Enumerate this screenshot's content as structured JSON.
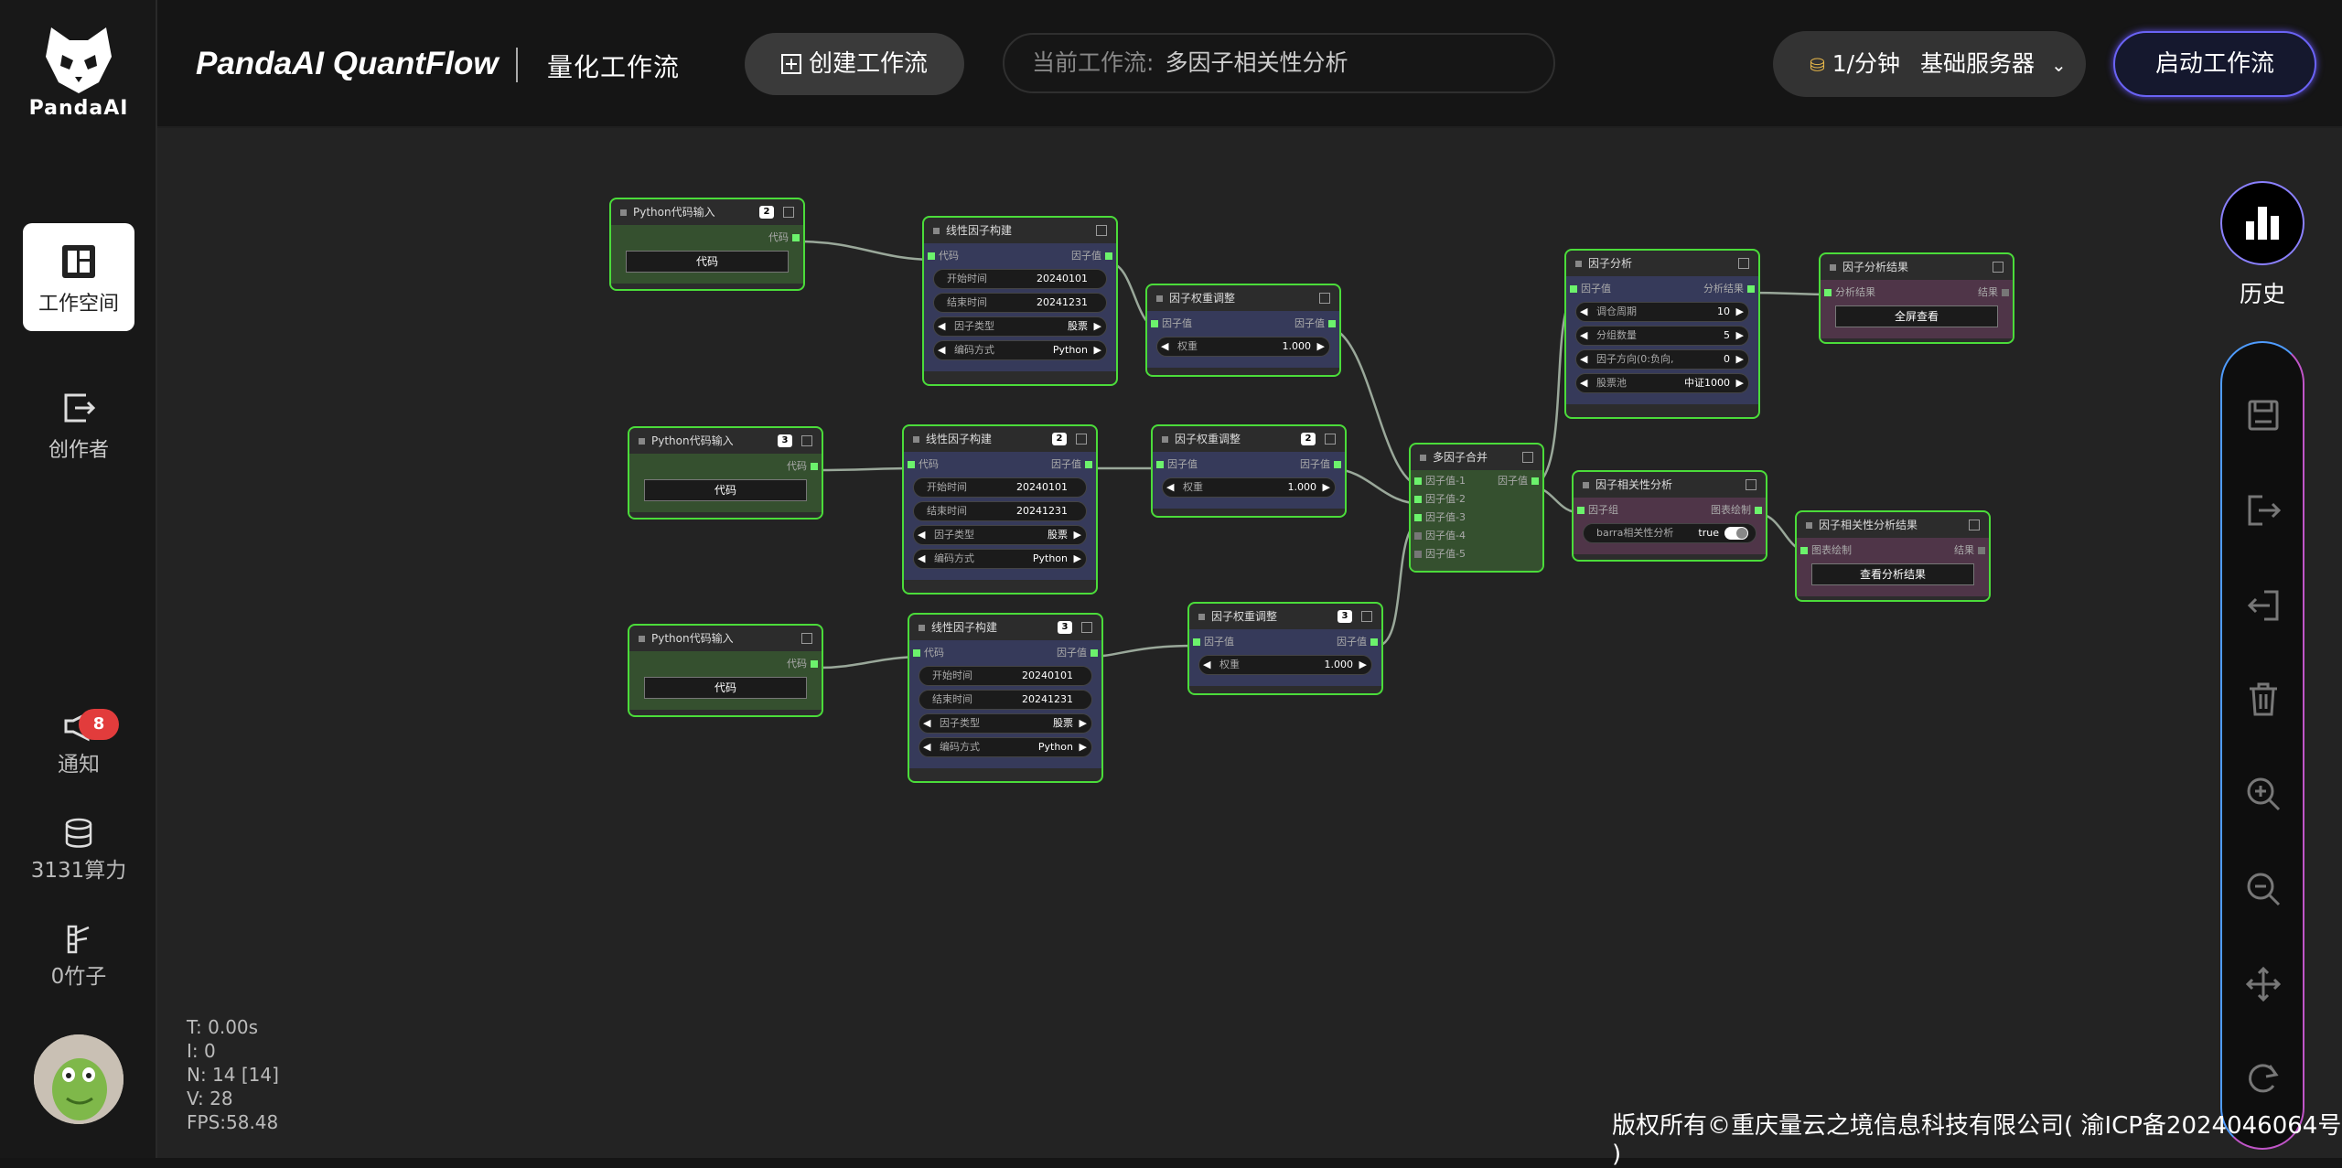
{
  "sidebar": {
    "logo_text": "PandaAI",
    "nav": [
      {
        "label": "工作空间",
        "icon": "workspace-icon",
        "active": true
      },
      {
        "label": "创作者",
        "icon": "creator-icon",
        "active": false
      }
    ],
    "notify": {
      "label": "通知",
      "count": "8",
      "icon": "megaphone-icon"
    },
    "compute": {
      "label": "3131算力",
      "icon": "database-icon"
    },
    "bamboo": {
      "label": "0竹子",
      "icon": "bamboo-icon"
    }
  },
  "header": {
    "brand": "PandaAI QuantFlow",
    "subtitle": "量化工作流",
    "create_label": "创建工作流",
    "current_label": "当前工作流:",
    "current_value": "多因子相关性分析",
    "rate": "1/分钟",
    "server": "基础服务器",
    "start_label": "启动工作流"
  },
  "right": {
    "history_label": "历史"
  },
  "stats": [
    "T: 0.00s",
    "I: 0",
    "N: 14 [14]",
    "V: 28",
    "FPS:58.48"
  ],
  "copyright": "版权所有©重庆量云之境信息科技有限公司( 渝ICP备2024046064号 )",
  "nodes": {
    "py1": {
      "title": "Python代码输入",
      "num": "2",
      "out": "代码",
      "btn": "代码"
    },
    "py2": {
      "title": "Python代码输入",
      "num": "3",
      "out": "代码",
      "btn": "代码"
    },
    "py3": {
      "title": "Python代码输入",
      "out": "代码",
      "btn": "代码"
    },
    "lin1": {
      "title": "线性因子构建",
      "in": "代码",
      "out": "因子值",
      "start_l": "开始时间",
      "start": "20240101",
      "end_l": "结束时间",
      "end": "20241231",
      "type_l": "因子类型",
      "type": "股票",
      "code_l": "编码方式",
      "code": "Python"
    },
    "lin2": {
      "title": "线性因子构建",
      "num": "2",
      "in": "代码",
      "out": "因子值",
      "start_l": "开始时间",
      "start": "20240101",
      "end_l": "结束时间",
      "end": "20241231",
      "type_l": "因子类型",
      "type": "股票",
      "code_l": "编码方式",
      "code": "Python"
    },
    "lin3": {
      "title": "线性因子构建",
      "num": "3",
      "in": "代码",
      "out": "因子值",
      "start_l": "开始时间",
      "start": "20240101",
      "end_l": "结束时间",
      "end": "20241231",
      "type_l": "因子类型",
      "type": "股票",
      "code_l": "编码方式",
      "code": "Python"
    },
    "w1": {
      "title": "因子权重调整",
      "in": "因子值",
      "out": "因子值",
      "wl": "权重",
      "w": "1.000"
    },
    "w2": {
      "title": "因子权重调整",
      "num": "2",
      "in": "因子值",
      "out": "因子值",
      "wl": "权重",
      "w": "1.000"
    },
    "w3": {
      "title": "因子权重调整",
      "num": "3",
      "in": "因子值",
      "out": "因子值",
      "wl": "权重",
      "w": "1.000"
    },
    "merge": {
      "title": "多因子合并",
      "in1": "因子值-1",
      "out": "因子值",
      "in2": "因子值-2",
      "in3": "因子值-3",
      "in4": "因子值-4",
      "in5": "因子值-5"
    },
    "fa": {
      "title": "因子分析",
      "in": "因子值",
      "out": "分析结果",
      "p1l": "调仓周期",
      "p1": "10",
      "p2l": "分组数量",
      "p2": "5",
      "p3l": "因子方向(0:负向,",
      "p3": "0",
      "p4l": "股票池",
      "p4": "中证1000"
    },
    "far": {
      "title": "因子分析结果",
      "in": "分析结果",
      "out": "结果",
      "btn": "全屏查看"
    },
    "corr": {
      "title": "因子相关性分析",
      "in": "因子组",
      "out": "图表绘制",
      "fl": "barra相关性分析",
      "fv": "true"
    },
    "corrr": {
      "title": "因子相关性分析结果",
      "in": "图表绘制",
      "out": "结果",
      "btn": "查看分析结果"
    }
  }
}
